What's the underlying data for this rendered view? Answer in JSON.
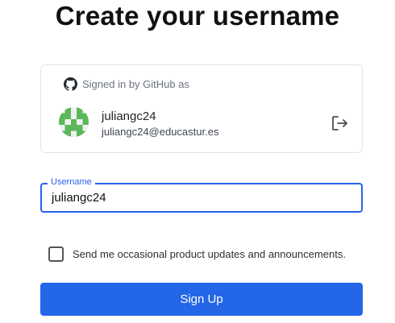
{
  "page": {
    "title": "Create your username"
  },
  "account": {
    "signed_in_text": "Signed in by GitHub as",
    "provider_icon": "github-icon",
    "name": "juliangc24",
    "email": "juliangc24@educastur.es",
    "signout_icon": "sign-out-icon"
  },
  "username": {
    "label": "Username",
    "value": "juliangc24"
  },
  "consent": {
    "label": "Send me occasional product updates and announcements.",
    "checked": false
  },
  "actions": {
    "signup_label": "Sign Up"
  },
  "colors": {
    "accent": "#2366e8",
    "avatar_green": "#5ab85a"
  }
}
